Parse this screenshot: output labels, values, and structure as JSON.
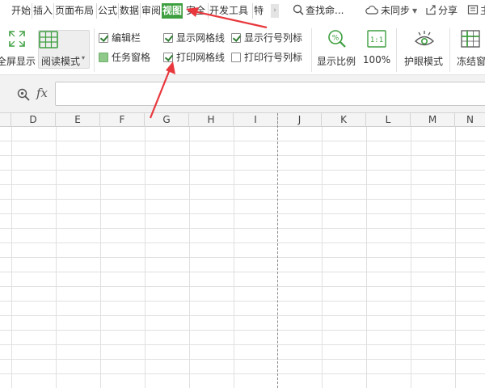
{
  "tabs": [
    {
      "label": "开始"
    },
    {
      "label": "插入"
    },
    {
      "label": "页面布局"
    },
    {
      "label": "公式"
    },
    {
      "label": "数据"
    },
    {
      "label": "审阅"
    },
    {
      "label": "视图"
    },
    {
      "label": "安全"
    },
    {
      "label": "开发工具"
    },
    {
      "label": "特"
    }
  ],
  "active_tab": "视图",
  "topbar": {
    "search": "查找命...",
    "sync": "未同步",
    "share": "分享",
    "more": "主"
  },
  "ribbon": {
    "fullscreen": "全屏显示",
    "reading_mode": "阅读模式",
    "checkboxes": [
      {
        "label": "编辑栏",
        "checked": true
      },
      {
        "label": "任务窗格",
        "checked": false
      },
      {
        "label": "显示网格线",
        "checked": true
      },
      {
        "label": "打印网格线",
        "checked": true
      },
      {
        "label": "显示行号列标",
        "checked": true
      },
      {
        "label": "打印行号列标",
        "checked": false
      }
    ],
    "zoom_ratio": "显示比例",
    "zoom_100": "100%",
    "zoom_100_icon_text": "1:1",
    "eye_protect": "护眼模式",
    "freeze": "冻结窗"
  },
  "formula_bar": {
    "fx": "fx",
    "value": ""
  },
  "columns": [
    "D",
    "E",
    "F",
    "G",
    "H",
    "I",
    "J",
    "K",
    "L",
    "M",
    "N"
  ],
  "colors": {
    "active_tab": "#3e9f40",
    "annotation": "#e8383d",
    "checkmark": "#2f7d32"
  }
}
